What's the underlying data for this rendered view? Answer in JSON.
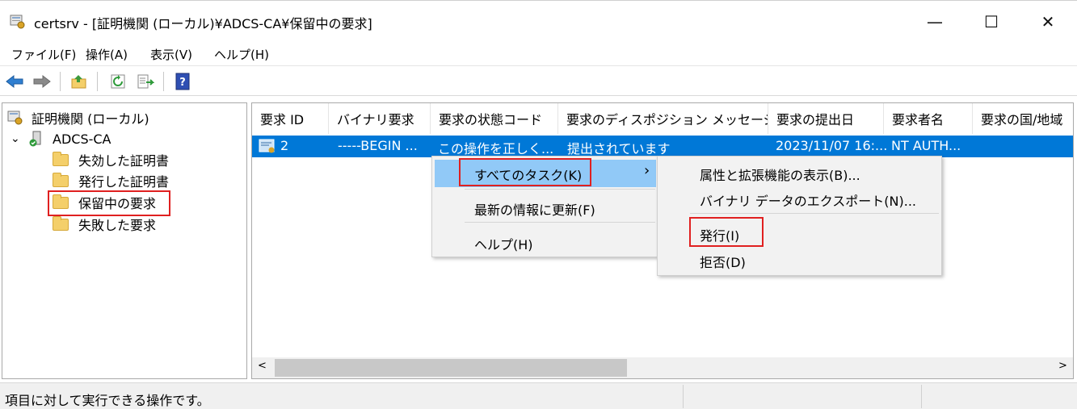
{
  "window": {
    "title": "certsrv - [証明機関 (ローカル)¥ADCS-CA¥保留中の要求]",
    "min_glyph": "—",
    "max_glyph": "☐",
    "close_glyph": "✕"
  },
  "menu": [
    "ファイル(F)",
    "操作(A)",
    "表示(V)",
    "ヘルプ(H)"
  ],
  "toolbar": {
    "icons": [
      "back-arrow-icon",
      "forward-arrow-icon",
      "up-folder-icon",
      "refresh-icon",
      "export-list-icon",
      "help-icon"
    ]
  },
  "tree": {
    "root": "証明機関 (ローカル)",
    "ca": "ADCS-CA",
    "expand_glyph": "⌄",
    "folders": [
      "失効した証明書",
      "発行した証明書",
      "保留中の要求",
      "失敗した要求"
    ]
  },
  "list": {
    "columns": [
      "要求 ID",
      "バイナリ要求",
      "要求の状態コード",
      "要求のディスポジション メッセージ",
      "要求の提出日",
      "要求者名",
      "要求の国/地域"
    ],
    "row": [
      "2",
      "-----BEGIN ...",
      "この操作を正しく...",
      "提出されています",
      "2023/11/07 16:...",
      "NT AUTH..."
    ],
    "scroll_left": "<",
    "scroll_right": ">"
  },
  "context_menu": {
    "items": [
      "すべてのタスク(K)",
      "最新の情報に更新(F)",
      "ヘルプ(H)"
    ],
    "submenu_arrow": "›"
  },
  "submenu": {
    "items": [
      "属性と拡張機能の表示(B)...",
      "バイナリ データのエクスポート(N)...",
      "発行(I)",
      "拒否(D)"
    ]
  },
  "status": {
    "text": "項目に対して実行できる操作です。"
  },
  "colors": {
    "selection": "#0078d7",
    "highlight_box": "#e02020",
    "folder": "#f4cf6a"
  }
}
